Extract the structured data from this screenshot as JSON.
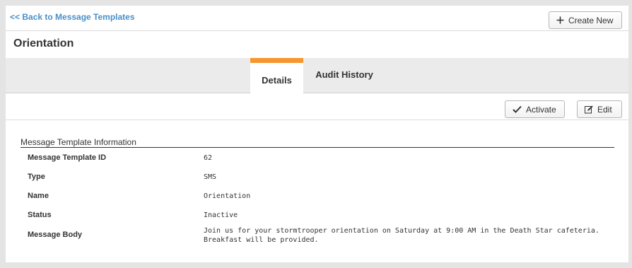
{
  "nav": {
    "back_label": "<< Back to Message Templates"
  },
  "toolbar": {
    "create_label": "Create New"
  },
  "page": {
    "title": "Orientation"
  },
  "tabs": [
    {
      "label": "Details",
      "active": true
    },
    {
      "label": "Audit History",
      "active": false
    }
  ],
  "actions": {
    "activate_label": "Activate",
    "edit_label": "Edit"
  },
  "section": {
    "title": "Message Template Information",
    "fields": [
      {
        "label": "Message Template ID",
        "value": "62"
      },
      {
        "label": "Type",
        "value": "SMS"
      },
      {
        "label": "Name",
        "value": "Orientation"
      },
      {
        "label": "Status",
        "value": "Inactive"
      },
      {
        "label": "Message Body",
        "value": "Join us for your stormtrooper orientation on Saturday at 9:00 AM in the Death Star cafeteria. Breakfast will be provided."
      }
    ]
  },
  "colors": {
    "accent_tab": "#f6962e",
    "link": "#4a8fc9"
  },
  "icons": {
    "create": "plus-icon",
    "activate": "checkmark-icon",
    "edit": "edit-icon"
  }
}
